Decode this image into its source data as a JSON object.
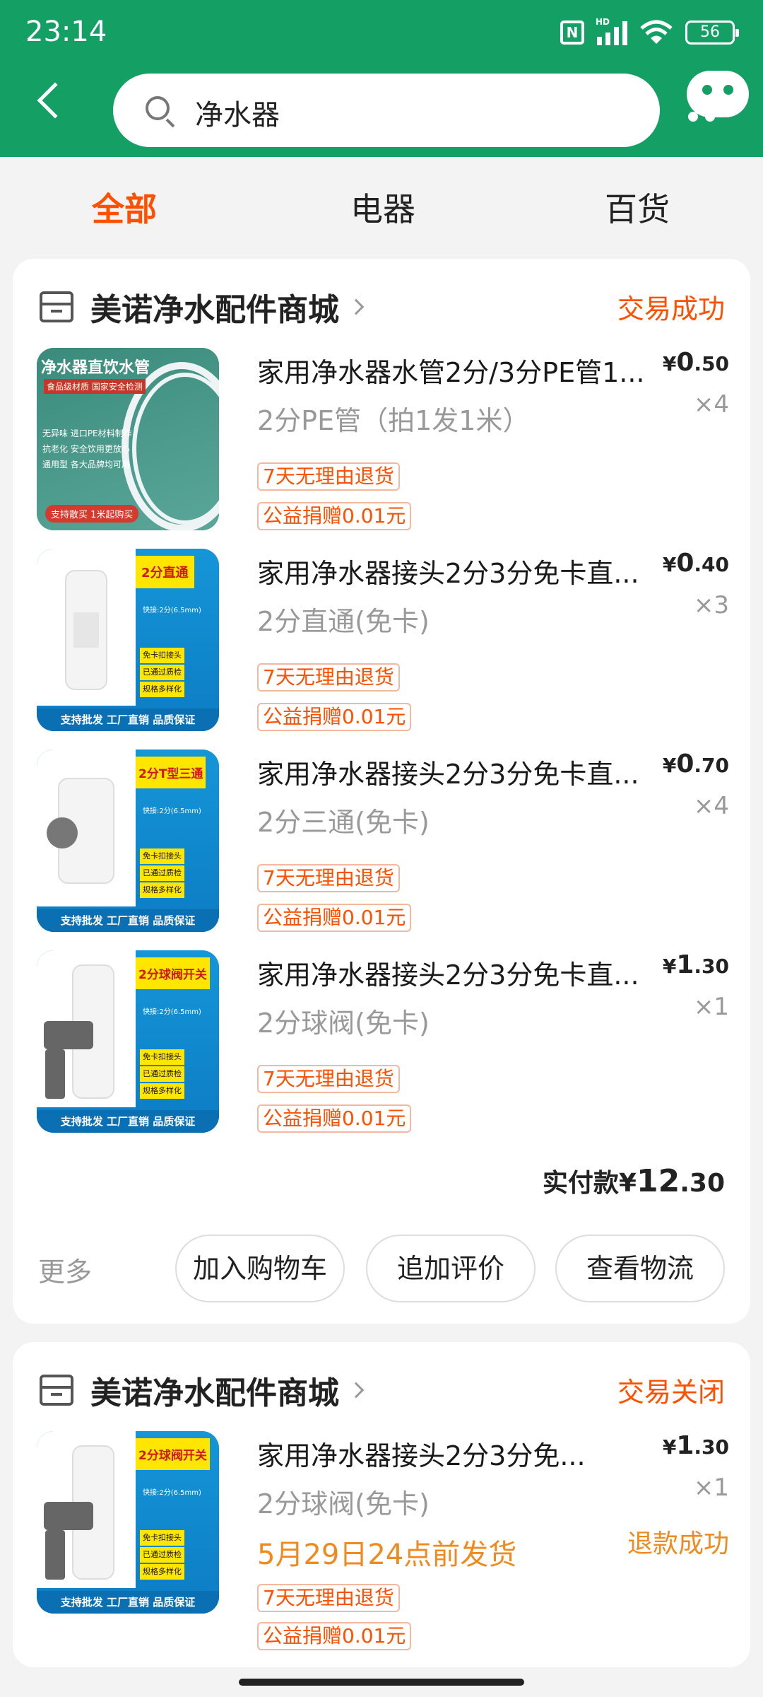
{
  "status_bar": {
    "time": "23:14",
    "network": "HD",
    "battery": "56"
  },
  "search": {
    "query": "净水器"
  },
  "tabs": [
    {
      "label": "全部",
      "active": true
    },
    {
      "label": "电器",
      "active": false
    },
    {
      "label": "百货",
      "active": false
    }
  ],
  "orders": [
    {
      "shop": "美诺净水配件商城",
      "status": "交易成功",
      "items": [
        {
          "title": "家用净水器水管2分/3分PE管1...",
          "spec": "2分PE管（拍1发1米）",
          "price_int": "0",
          "price_dec": ".50",
          "qty": "×4",
          "tags": [
            "7天无理由退货",
            "公益捐赠0.01元"
          ],
          "thumb": {
            "top_text": "净水器直饮水管",
            "sub": "食品级材质  国家安全检测",
            "list": [
              "无异味 进口PE材料制作",
              "抗老化 安全饮用更放心",
              "通用型 各大品牌均可用"
            ],
            "bottom": "支持散买 1米起购买"
          }
        },
        {
          "title": "家用净水器接头2分3分免卡直...",
          "spec": "2分直通(免卡)",
          "price_int": "0",
          "price_dec": ".40",
          "qty": "×3",
          "tags": [
            "7天无理由退货",
            "公益捐赠0.01元"
          ],
          "thumb": {
            "top_text": "2分直通",
            "sub": "快接:2分(6.5mm)",
            "list": [
              "免卡扣接头",
              "已通过质检",
              "规格多样化"
            ],
            "bottom": "支持批发 工厂直销 品质保证"
          }
        },
        {
          "title": "家用净水器接头2分3分免卡直...",
          "spec": "2分三通(免卡)",
          "price_int": "0",
          "price_dec": ".70",
          "qty": "×4",
          "tags": [
            "7天无理由退货",
            "公益捐赠0.01元"
          ],
          "thumb": {
            "top_text": "2分T型三通",
            "sub": "快接:2分(6.5mm)",
            "list": [
              "免卡扣接头",
              "已通过质检",
              "规格多样化"
            ],
            "bottom": "支持批发 工厂直销 品质保证"
          }
        },
        {
          "title": "家用净水器接头2分3分免卡直...",
          "spec": "2分球阀(免卡)",
          "price_int": "1",
          "price_dec": ".30",
          "qty": "×1",
          "tags": [
            "7天无理由退货",
            "公益捐赠0.01元"
          ],
          "thumb": {
            "top_text": "2分球阀开关",
            "sub": "快接:2分(6.5mm)",
            "list": [
              "免卡扣接头",
              "已通过质检",
              "规格多样化"
            ],
            "bottom": "支持批发 工厂直销 品质保证"
          }
        }
      ],
      "total_label": "实付款",
      "total_int": "12",
      "total_dec": ".30",
      "more": "更多",
      "actions": [
        "加入购物车",
        "追加评价",
        "查看物流"
      ]
    },
    {
      "shop": "美诺净水配件商城",
      "status": "交易关闭",
      "items": [
        {
          "title": "家用净水器接头2分3分免...",
          "spec": "2分球阀(免卡)",
          "price_int": "1",
          "price_dec": ".30",
          "qty": "×1",
          "ship": "5月29日24点前发货",
          "refund": "退款成功",
          "tags": [
            "7天无理由退货",
            "公益捐赠0.01元"
          ],
          "thumb": {
            "top_text": "2分球阀开关",
            "sub": "快接:2分(6.5mm)",
            "list": [
              "免卡扣接头",
              "已通过质检",
              "规格多样化"
            ],
            "bottom": "支持批发 工厂直销 品质保证"
          }
        }
      ]
    }
  ],
  "currency": "¥",
  "colors": {
    "brand": "#14a065",
    "accent": "#ff5000",
    "warn": "#f08a1e"
  }
}
